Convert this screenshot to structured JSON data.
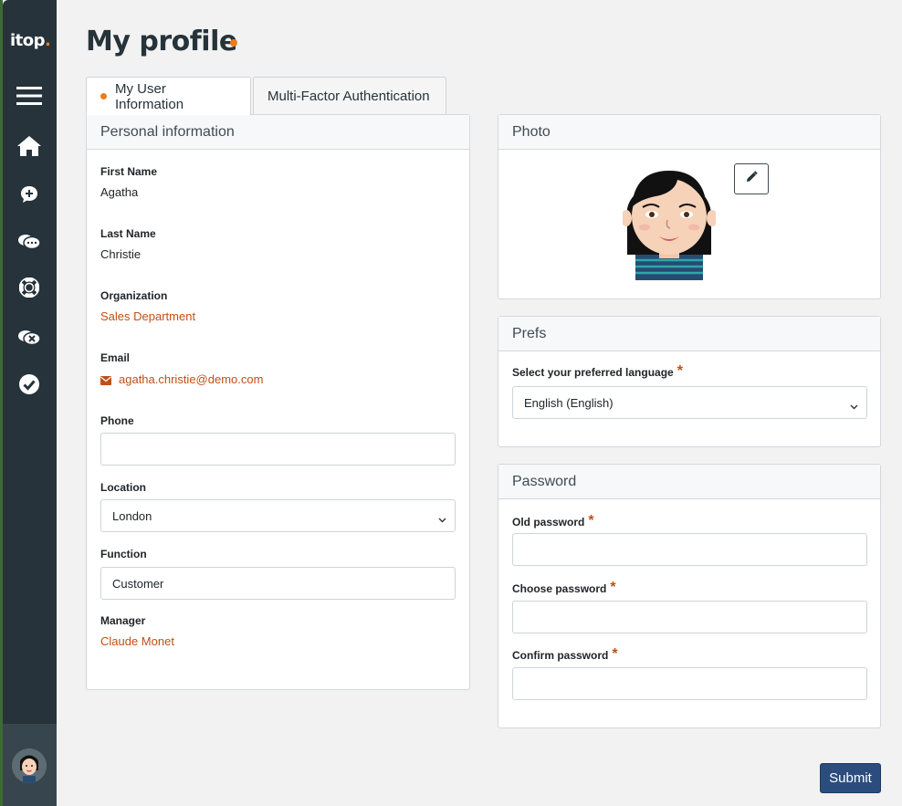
{
  "app": {
    "logo_text": "itop",
    "logo_dot": "."
  },
  "sidebar": {
    "items": [
      {
        "icon": "hamburger-icon"
      },
      {
        "icon": "home-icon"
      },
      {
        "icon": "new-request-icon"
      },
      {
        "icon": "ongoing-requests-icon"
      },
      {
        "icon": "lifebuoy-icon"
      },
      {
        "icon": "closed-requests-icon"
      },
      {
        "icon": "check-circle-icon"
      }
    ]
  },
  "page": {
    "title": "My profile"
  },
  "tabs": [
    {
      "label": "My User Information",
      "active": true
    },
    {
      "label": "Multi-Factor Authentication",
      "active": false
    }
  ],
  "personal": {
    "header": "Personal information",
    "first_name_label": "First Name",
    "first_name": "Agatha",
    "last_name_label": "Last Name",
    "last_name": "Christie",
    "organization_label": "Organization",
    "organization": "Sales Department",
    "email_label": "Email",
    "email": "agatha.christie@demo.com",
    "phone_label": "Phone",
    "phone": "",
    "location_label": "Location",
    "location": "London",
    "function_label": "Function",
    "function": "Customer",
    "manager_label": "Manager",
    "manager": "Claude Monet"
  },
  "photo": {
    "header": "Photo"
  },
  "prefs": {
    "header": "Prefs",
    "language_label": "Select your preferred language",
    "language": "English (English)"
  },
  "password": {
    "header": "Password",
    "old_label": "Old password",
    "choose_label": "Choose password",
    "confirm_label": "Confirm password",
    "required_mark": "*"
  },
  "actions": {
    "submit_label": "Submit"
  },
  "colors": {
    "accent": "#ea7d1e",
    "link": "#c05016",
    "sidebar": "#26333a",
    "primary_button": "#2b4d7e"
  }
}
